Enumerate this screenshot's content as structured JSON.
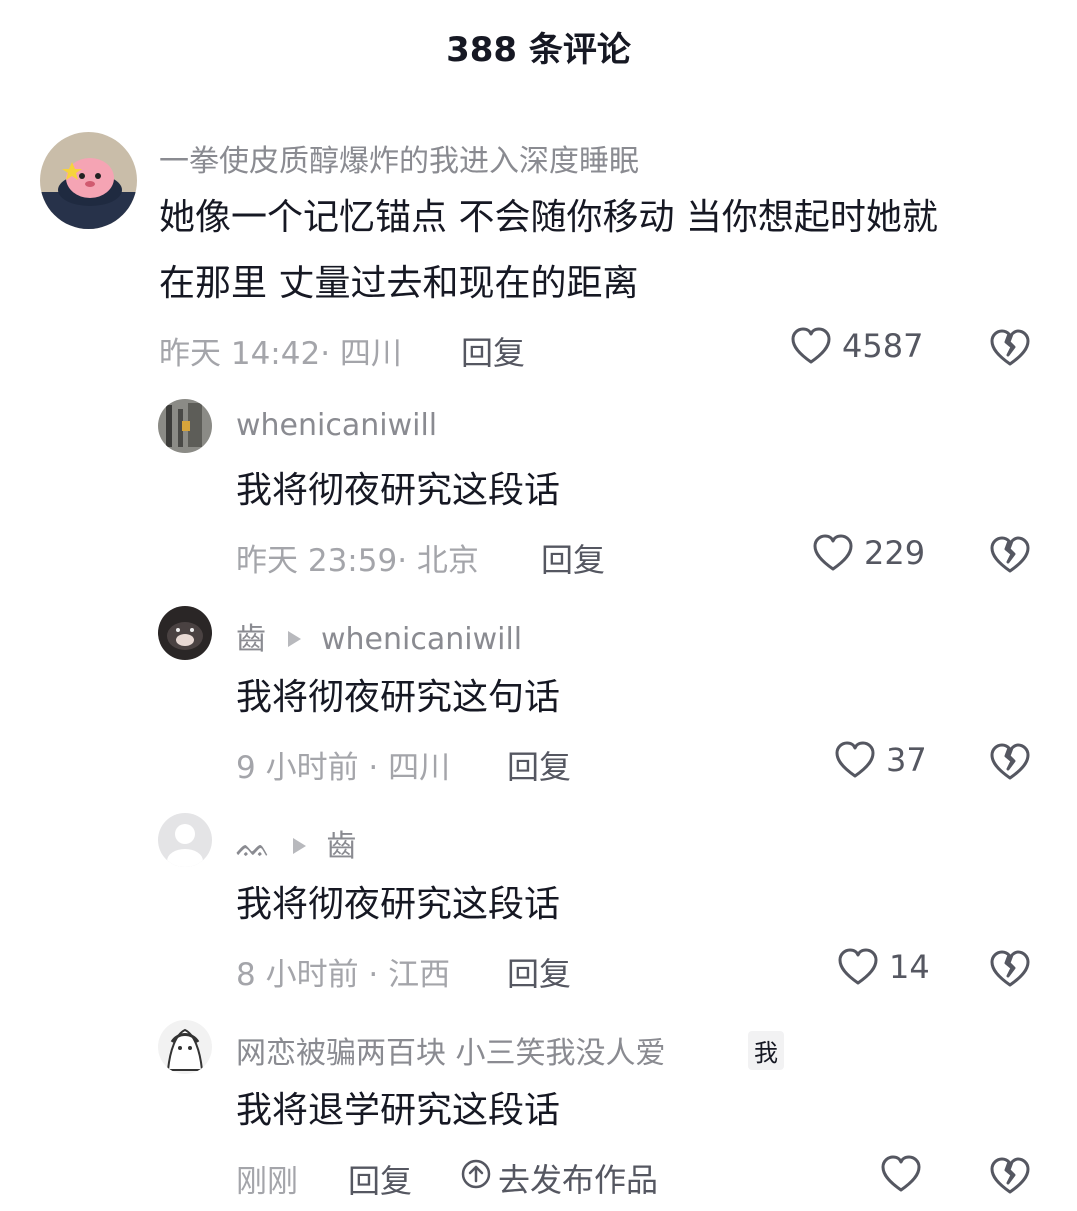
{
  "header": {
    "title": "388 条评论"
  },
  "comments": [
    {
      "username": "一拳使皮质醇爆炸的我进入深度睡眠",
      "text_line1": "她像一个记忆锚点 不会随你移动 当你想起时她就",
      "text_line2": "在那里 丈量过去和现在的距离",
      "time": "昨天 14:42· 四川",
      "reply": "回复",
      "likes": "4587"
    },
    {
      "username": "whenicaniwill",
      "text": "我将彻夜研究这段话",
      "time": "昨天 23:59· 北京",
      "reply": "回复",
      "likes": "229"
    },
    {
      "username": "齒",
      "reply_to": "whenicaniwill",
      "text": "我将彻夜研究这句话",
      "time": "9 小时前 · 四川",
      "reply": "回复",
      "likes": "37"
    },
    {
      "username": "ᨐ",
      "reply_to": "齒",
      "text": "我将彻夜研究这段话",
      "time": "8 小时前 · 江西",
      "reply": "回复",
      "likes": "14"
    },
    {
      "username": "网恋被骗两百块 小三笑我没人爱",
      "badge": "我",
      "text": "我将退学研究这段话",
      "time": "刚刚",
      "reply": "回复",
      "publish": "去发布作品"
    }
  ],
  "icons": {
    "like": "heart-outline-icon",
    "dislike": "broken-heart-icon",
    "reply_arrow": "triangle-right-icon",
    "publish": "up-arrow-circle-icon"
  },
  "colors": {
    "primary_text": "#161823",
    "secondary_text": "#8a8b91",
    "meta_text": "#a4a5aa",
    "action_text": "#555761"
  }
}
